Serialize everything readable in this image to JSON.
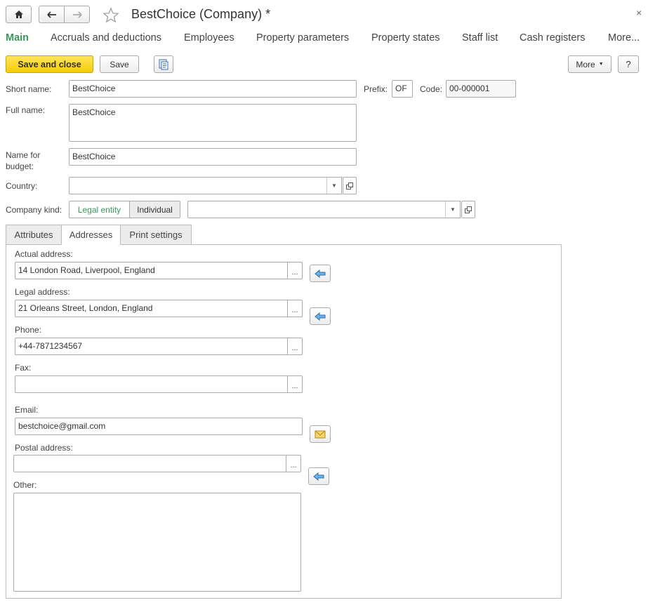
{
  "window": {
    "title": "BestChoice (Company) *",
    "close_glyph": "×"
  },
  "nav": {
    "tabs": [
      {
        "label": "Main",
        "active": true
      },
      {
        "label": "Accruals and deductions"
      },
      {
        "label": "Employees"
      },
      {
        "label": "Property parameters"
      },
      {
        "label": "Property states"
      },
      {
        "label": "Staff list"
      },
      {
        "label": "Cash registers"
      },
      {
        "label": "More..."
      }
    ]
  },
  "toolbar": {
    "save_and_close": "Save and close",
    "save": "Save",
    "more": "More",
    "help": "?"
  },
  "form": {
    "short_name_label": "Short name:",
    "short_name": "BestChoice",
    "prefix_label": "Prefix:",
    "prefix": "OF",
    "code_label": "Code:",
    "code": "00-000001",
    "full_name_label": "Full name:",
    "full_name": "BestChoice",
    "budget_name_label": "Name for budget:",
    "budget_name": "BestChoice",
    "country_label": "Country:",
    "country": "",
    "company_kind_label": "Company kind:",
    "kind_legal": "Legal entity",
    "kind_individual": "Individual",
    "kind_selected": "Legal entity",
    "kind_extra": ""
  },
  "tabs": [
    {
      "label": "Attributes"
    },
    {
      "label": "Addresses",
      "active": true
    },
    {
      "label": "Print settings"
    }
  ],
  "addresses": {
    "actual_label": "Actual address:",
    "actual": "14 London Road, Liverpool, England",
    "legal_label": "Legal address:",
    "legal": "21 Orleans Street, London, England",
    "phone_label": "Phone:",
    "phone": "+44-7871234567",
    "fax_label": "Fax:",
    "fax": "",
    "email_label": "Email:",
    "email": "bestchoice@gmail.com",
    "postal_label": "Postal address:",
    "postal": "",
    "other_label": "Other:",
    "other": "",
    "dots": "..."
  },
  "colors": {
    "accent_green": "#3b9a5b",
    "primary_button": "#f5cc08"
  },
  "icons": [
    "home-icon",
    "back-arrow-icon",
    "forward-arrow-icon",
    "star-icon",
    "document-list-icon",
    "open-form-icon",
    "fill-from-arrow-icon",
    "envelope-icon",
    "dropdown-arrow-icon"
  ]
}
